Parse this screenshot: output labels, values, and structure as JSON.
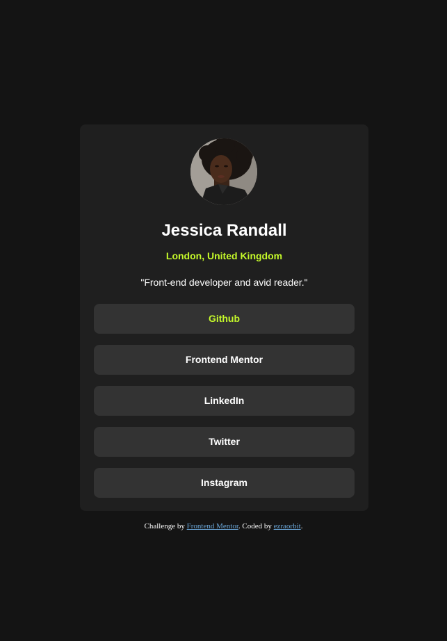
{
  "profile": {
    "name": "Jessica Randall",
    "location": "London, United Kingdom",
    "bio": "\"Front-end developer and avid reader.\""
  },
  "links": [
    {
      "label": "Github",
      "active": true
    },
    {
      "label": "Frontend Mentor",
      "active": false
    },
    {
      "label": "LinkedIn",
      "active": false
    },
    {
      "label": "Twitter",
      "active": false
    },
    {
      "label": "Instagram",
      "active": false
    }
  ],
  "attribution": {
    "prefix": "Challenge by ",
    "challenge_link": "Frontend Mentor",
    "middle": ". Coded by ",
    "author_link": "ezraorbit",
    "suffix": "."
  },
  "colors": {
    "page_background": "#141414",
    "card_background": "#1f1f1f",
    "button_background": "#333333",
    "accent": "#c4f82a",
    "text": "#ffffff",
    "link": "#6aa6d8"
  }
}
